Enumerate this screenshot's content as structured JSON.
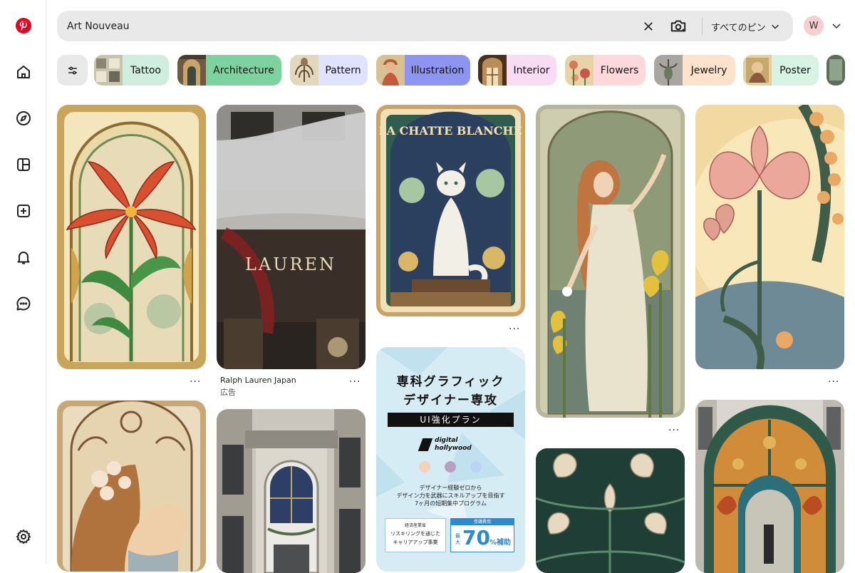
{
  "search": {
    "value": "Art Nouveau",
    "filter_label": "すべてのピン"
  },
  "account": {
    "initial": "W"
  },
  "chips": [
    {
      "label": "Tattoo",
      "bg": "#cfeee0"
    },
    {
      "label": "Architecture",
      "bg": "#7dd3a0"
    },
    {
      "label": "Pattern",
      "bg": "#dfe3ff"
    },
    {
      "label": "Illustration",
      "bg": "#8d95f0"
    },
    {
      "label": "Interior",
      "bg": "#f8dcf4"
    },
    {
      "label": "Flowers",
      "bg": "#ffd8dc"
    },
    {
      "label": "Jewelry",
      "bg": "#ffe2cc"
    },
    {
      "label": "Poster",
      "bg": "#d7f3e3"
    }
  ],
  "pins": {
    "lily": {
      "caption": "···"
    },
    "lauren": {
      "sign": "LAUREN",
      "title": "Ralph Lauren Japan",
      "sub": "広告",
      "more": "···"
    },
    "cat": {
      "poster_title": "LA CHATTE BLANCHE",
      "more": "···"
    },
    "woman": {
      "more": "···"
    },
    "flower": {
      "more": "···"
    },
    "ad2": {
      "line1": "専科グラフィック",
      "line2": "デザイナー専攻",
      "badge": "UI強化プラン",
      "logo1": "digital",
      "logo2": "hollywood",
      "desc1": "デザイナー経験ゼロから",
      "desc2": "デザイン力を武器にスキルアップを目指す",
      "desc3": "7ヶ月の短期集中プログラム",
      "box1a": "経済産業省",
      "box1b": "リスキリングを通じた",
      "box1c": "キャリアアップ事業",
      "box2a": "受講費用",
      "box2b": "最大",
      "box2c": "70",
      "box2d": "%補助"
    }
  }
}
